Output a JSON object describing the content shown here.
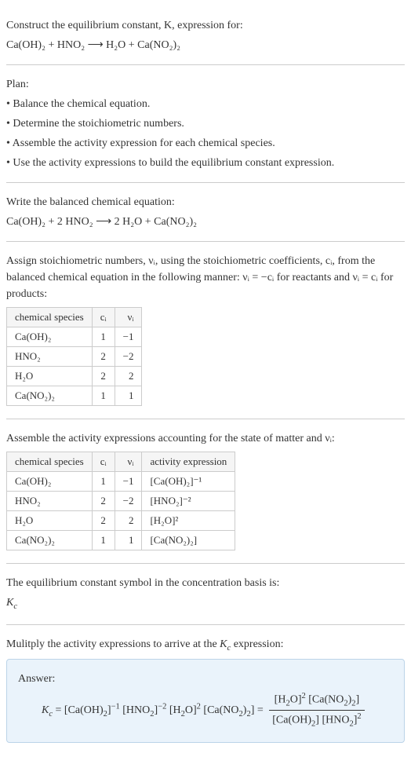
{
  "prompt": {
    "title": "Construct the equilibrium constant, K, expression for:",
    "equation": "Ca(OH)₂ + HNO₂  ⟶  H₂O + Ca(NO₂)₂"
  },
  "plan": {
    "heading": "Plan:",
    "bullets": [
      "• Balance the chemical equation.",
      "• Determine the stoichiometric numbers.",
      "• Assemble the activity expression for each chemical species.",
      "• Use the activity expressions to build the equilibrium constant expression."
    ]
  },
  "balanced": {
    "heading": "Write the balanced chemical equation:",
    "equation": "Ca(OH)₂ + 2 HNO₂  ⟶  2 H₂O + Ca(NO₂)₂"
  },
  "stoich": {
    "intro1": "Assign stoichiometric numbers, νᵢ, using the stoichiometric coefficients, cᵢ, from the balanced chemical equation in the following manner: νᵢ = −cᵢ for reactants and νᵢ = cᵢ for products:",
    "headers": {
      "species": "chemical species",
      "c": "cᵢ",
      "v": "νᵢ"
    },
    "rows": [
      {
        "species": "Ca(OH)₂",
        "c": "1",
        "v": "−1"
      },
      {
        "species": "HNO₂",
        "c": "2",
        "v": "−2"
      },
      {
        "species": "H₂O",
        "c": "2",
        "v": "2"
      },
      {
        "species": "Ca(NO₂)₂",
        "c": "1",
        "v": "1"
      }
    ]
  },
  "activity": {
    "intro": "Assemble the activity expressions accounting for the state of matter and νᵢ:",
    "headers": {
      "species": "chemical species",
      "c": "cᵢ",
      "v": "νᵢ",
      "expr": "activity expression"
    },
    "rows": [
      {
        "species": "Ca(OH)₂",
        "c": "1",
        "v": "−1",
        "expr": "[Ca(OH)₂]⁻¹"
      },
      {
        "species": "HNO₂",
        "c": "2",
        "v": "−2",
        "expr": "[HNO₂]⁻²"
      },
      {
        "species": "H₂O",
        "c": "2",
        "v": "2",
        "expr": "[H₂O]²"
      },
      {
        "species": "Ca(NO₂)₂",
        "c": "1",
        "v": "1",
        "expr": "[Ca(NO₂)₂]"
      }
    ]
  },
  "symbol": {
    "line1": "The equilibrium constant symbol in the concentration basis is:",
    "kc": "K_c"
  },
  "mult": {
    "line": "Mulitply the activity expressions to arrive at the K_c expression:"
  },
  "answer": {
    "label": "Answer:",
    "lhs": "K_c = [Ca(OH)₂]⁻¹ [HNO₂]⁻² [H₂O]² [Ca(NO₂)₂] = ",
    "num": "[H₂O]² [Ca(NO₂)₂]",
    "den": "[Ca(OH)₂] [HNO₂]²"
  }
}
